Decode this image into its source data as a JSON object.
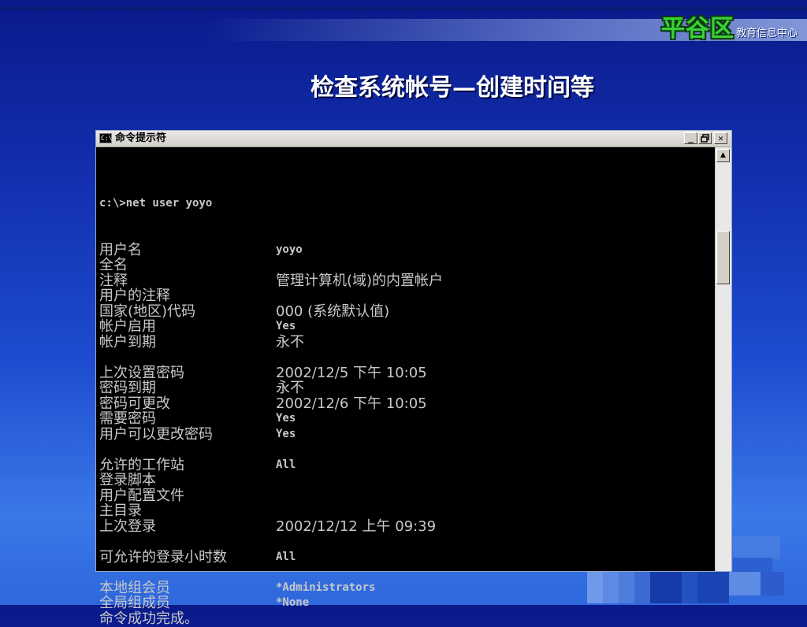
{
  "logo": {
    "main": "平谷区",
    "sub": "教育信息中心"
  },
  "slide": {
    "title": "检查系统帐号—创建时间等"
  },
  "window": {
    "icon_text": "C:\\",
    "title": "命令提示符",
    "buttons": {
      "minimize": "_",
      "restore": "🗗",
      "close": "✕"
    }
  },
  "console": {
    "command": "c:\\>net user yoyo",
    "groups": [
      [
        {
          "label": "用户名",
          "value": "yoyo",
          "cjk": false
        },
        {
          "label": "全名",
          "value": "",
          "cjk": false
        },
        {
          "label": "注释",
          "value": "管理计算机(域)的内置帐户",
          "cjk": true
        },
        {
          "label": "用户的注释",
          "value": "",
          "cjk": false
        },
        {
          "label": "国家(地区)代码",
          "value": "000 (系统默认值)",
          "cjk": true
        },
        {
          "label": "帐户启用",
          "value": "Yes",
          "cjk": false
        },
        {
          "label": "帐户到期",
          "value": "永不",
          "cjk": true
        }
      ],
      [
        {
          "label": "上次设置密码",
          "value": "2002/12/5 下午 10:05",
          "cjk": true
        },
        {
          "label": "密码到期",
          "value": "永不",
          "cjk": true
        },
        {
          "label": "密码可更改",
          "value": "2002/12/6 下午 10:05",
          "cjk": true
        },
        {
          "label": "需要密码",
          "value": "Yes",
          "cjk": false
        },
        {
          "label": "用户可以更改密码",
          "value": "Yes",
          "cjk": false
        }
      ],
      [
        {
          "label": "允许的工作站",
          "value": "All",
          "cjk": false
        },
        {
          "label": "登录脚本",
          "value": "",
          "cjk": false
        },
        {
          "label": "用户配置文件",
          "value": "",
          "cjk": false
        },
        {
          "label": "主目录",
          "value": "",
          "cjk": false
        },
        {
          "label": "上次登录",
          "value": "2002/12/12 上午 09:39",
          "cjk": true
        }
      ],
      [
        {
          "label": "可允许的登录小时数",
          "value": "All",
          "cjk": false
        }
      ],
      [
        {
          "label": "本地组会员",
          "value": "*Administrators",
          "cjk": false
        },
        {
          "label": "全局组成员",
          "value": "*None",
          "cjk": false
        },
        {
          "label": "命令成功完成。",
          "value": "",
          "cjk": false
        }
      ]
    ]
  },
  "colors": {
    "console_bg": "#000000",
    "console_text": "#c8c8c8",
    "logo_green": "#39d139",
    "slide_blue": "#1e4cd0"
  }
}
